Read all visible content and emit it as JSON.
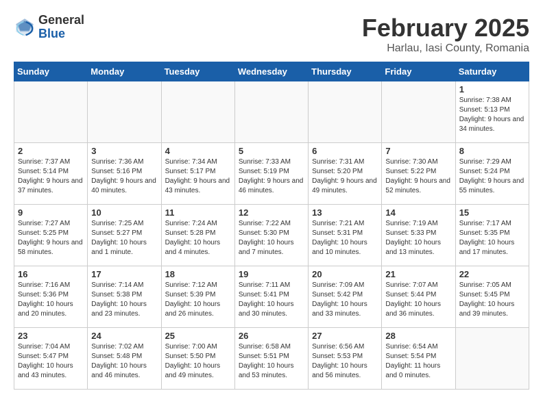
{
  "header": {
    "logo_general": "General",
    "logo_blue": "Blue",
    "title": "February 2025",
    "subtitle": "Harlau, Iasi County, Romania"
  },
  "weekdays": [
    "Sunday",
    "Monday",
    "Tuesday",
    "Wednesday",
    "Thursday",
    "Friday",
    "Saturday"
  ],
  "weeks": [
    [
      {
        "day": "",
        "info": ""
      },
      {
        "day": "",
        "info": ""
      },
      {
        "day": "",
        "info": ""
      },
      {
        "day": "",
        "info": ""
      },
      {
        "day": "",
        "info": ""
      },
      {
        "day": "",
        "info": ""
      },
      {
        "day": "1",
        "info": "Sunrise: 7:38 AM\nSunset: 5:13 PM\nDaylight: 9 hours and 34 minutes."
      }
    ],
    [
      {
        "day": "2",
        "info": "Sunrise: 7:37 AM\nSunset: 5:14 PM\nDaylight: 9 hours and 37 minutes."
      },
      {
        "day": "3",
        "info": "Sunrise: 7:36 AM\nSunset: 5:16 PM\nDaylight: 9 hours and 40 minutes."
      },
      {
        "day": "4",
        "info": "Sunrise: 7:34 AM\nSunset: 5:17 PM\nDaylight: 9 hours and 43 minutes."
      },
      {
        "day": "5",
        "info": "Sunrise: 7:33 AM\nSunset: 5:19 PM\nDaylight: 9 hours and 46 minutes."
      },
      {
        "day": "6",
        "info": "Sunrise: 7:31 AM\nSunset: 5:20 PM\nDaylight: 9 hours and 49 minutes."
      },
      {
        "day": "7",
        "info": "Sunrise: 7:30 AM\nSunset: 5:22 PM\nDaylight: 9 hours and 52 minutes."
      },
      {
        "day": "8",
        "info": "Sunrise: 7:29 AM\nSunset: 5:24 PM\nDaylight: 9 hours and 55 minutes."
      }
    ],
    [
      {
        "day": "9",
        "info": "Sunrise: 7:27 AM\nSunset: 5:25 PM\nDaylight: 9 hours and 58 minutes."
      },
      {
        "day": "10",
        "info": "Sunrise: 7:25 AM\nSunset: 5:27 PM\nDaylight: 10 hours and 1 minute."
      },
      {
        "day": "11",
        "info": "Sunrise: 7:24 AM\nSunset: 5:28 PM\nDaylight: 10 hours and 4 minutes."
      },
      {
        "day": "12",
        "info": "Sunrise: 7:22 AM\nSunset: 5:30 PM\nDaylight: 10 hours and 7 minutes."
      },
      {
        "day": "13",
        "info": "Sunrise: 7:21 AM\nSunset: 5:31 PM\nDaylight: 10 hours and 10 minutes."
      },
      {
        "day": "14",
        "info": "Sunrise: 7:19 AM\nSunset: 5:33 PM\nDaylight: 10 hours and 13 minutes."
      },
      {
        "day": "15",
        "info": "Sunrise: 7:17 AM\nSunset: 5:35 PM\nDaylight: 10 hours and 17 minutes."
      }
    ],
    [
      {
        "day": "16",
        "info": "Sunrise: 7:16 AM\nSunset: 5:36 PM\nDaylight: 10 hours and 20 minutes."
      },
      {
        "day": "17",
        "info": "Sunrise: 7:14 AM\nSunset: 5:38 PM\nDaylight: 10 hours and 23 minutes."
      },
      {
        "day": "18",
        "info": "Sunrise: 7:12 AM\nSunset: 5:39 PM\nDaylight: 10 hours and 26 minutes."
      },
      {
        "day": "19",
        "info": "Sunrise: 7:11 AM\nSunset: 5:41 PM\nDaylight: 10 hours and 30 minutes."
      },
      {
        "day": "20",
        "info": "Sunrise: 7:09 AM\nSunset: 5:42 PM\nDaylight: 10 hours and 33 minutes."
      },
      {
        "day": "21",
        "info": "Sunrise: 7:07 AM\nSunset: 5:44 PM\nDaylight: 10 hours and 36 minutes."
      },
      {
        "day": "22",
        "info": "Sunrise: 7:05 AM\nSunset: 5:45 PM\nDaylight: 10 hours and 39 minutes."
      }
    ],
    [
      {
        "day": "23",
        "info": "Sunrise: 7:04 AM\nSunset: 5:47 PM\nDaylight: 10 hours and 43 minutes."
      },
      {
        "day": "24",
        "info": "Sunrise: 7:02 AM\nSunset: 5:48 PM\nDaylight: 10 hours and 46 minutes."
      },
      {
        "day": "25",
        "info": "Sunrise: 7:00 AM\nSunset: 5:50 PM\nDaylight: 10 hours and 49 minutes."
      },
      {
        "day": "26",
        "info": "Sunrise: 6:58 AM\nSunset: 5:51 PM\nDaylight: 10 hours and 53 minutes."
      },
      {
        "day": "27",
        "info": "Sunrise: 6:56 AM\nSunset: 5:53 PM\nDaylight: 10 hours and 56 minutes."
      },
      {
        "day": "28",
        "info": "Sunrise: 6:54 AM\nSunset: 5:54 PM\nDaylight: 11 hours and 0 minutes."
      },
      {
        "day": "",
        "info": ""
      }
    ]
  ]
}
